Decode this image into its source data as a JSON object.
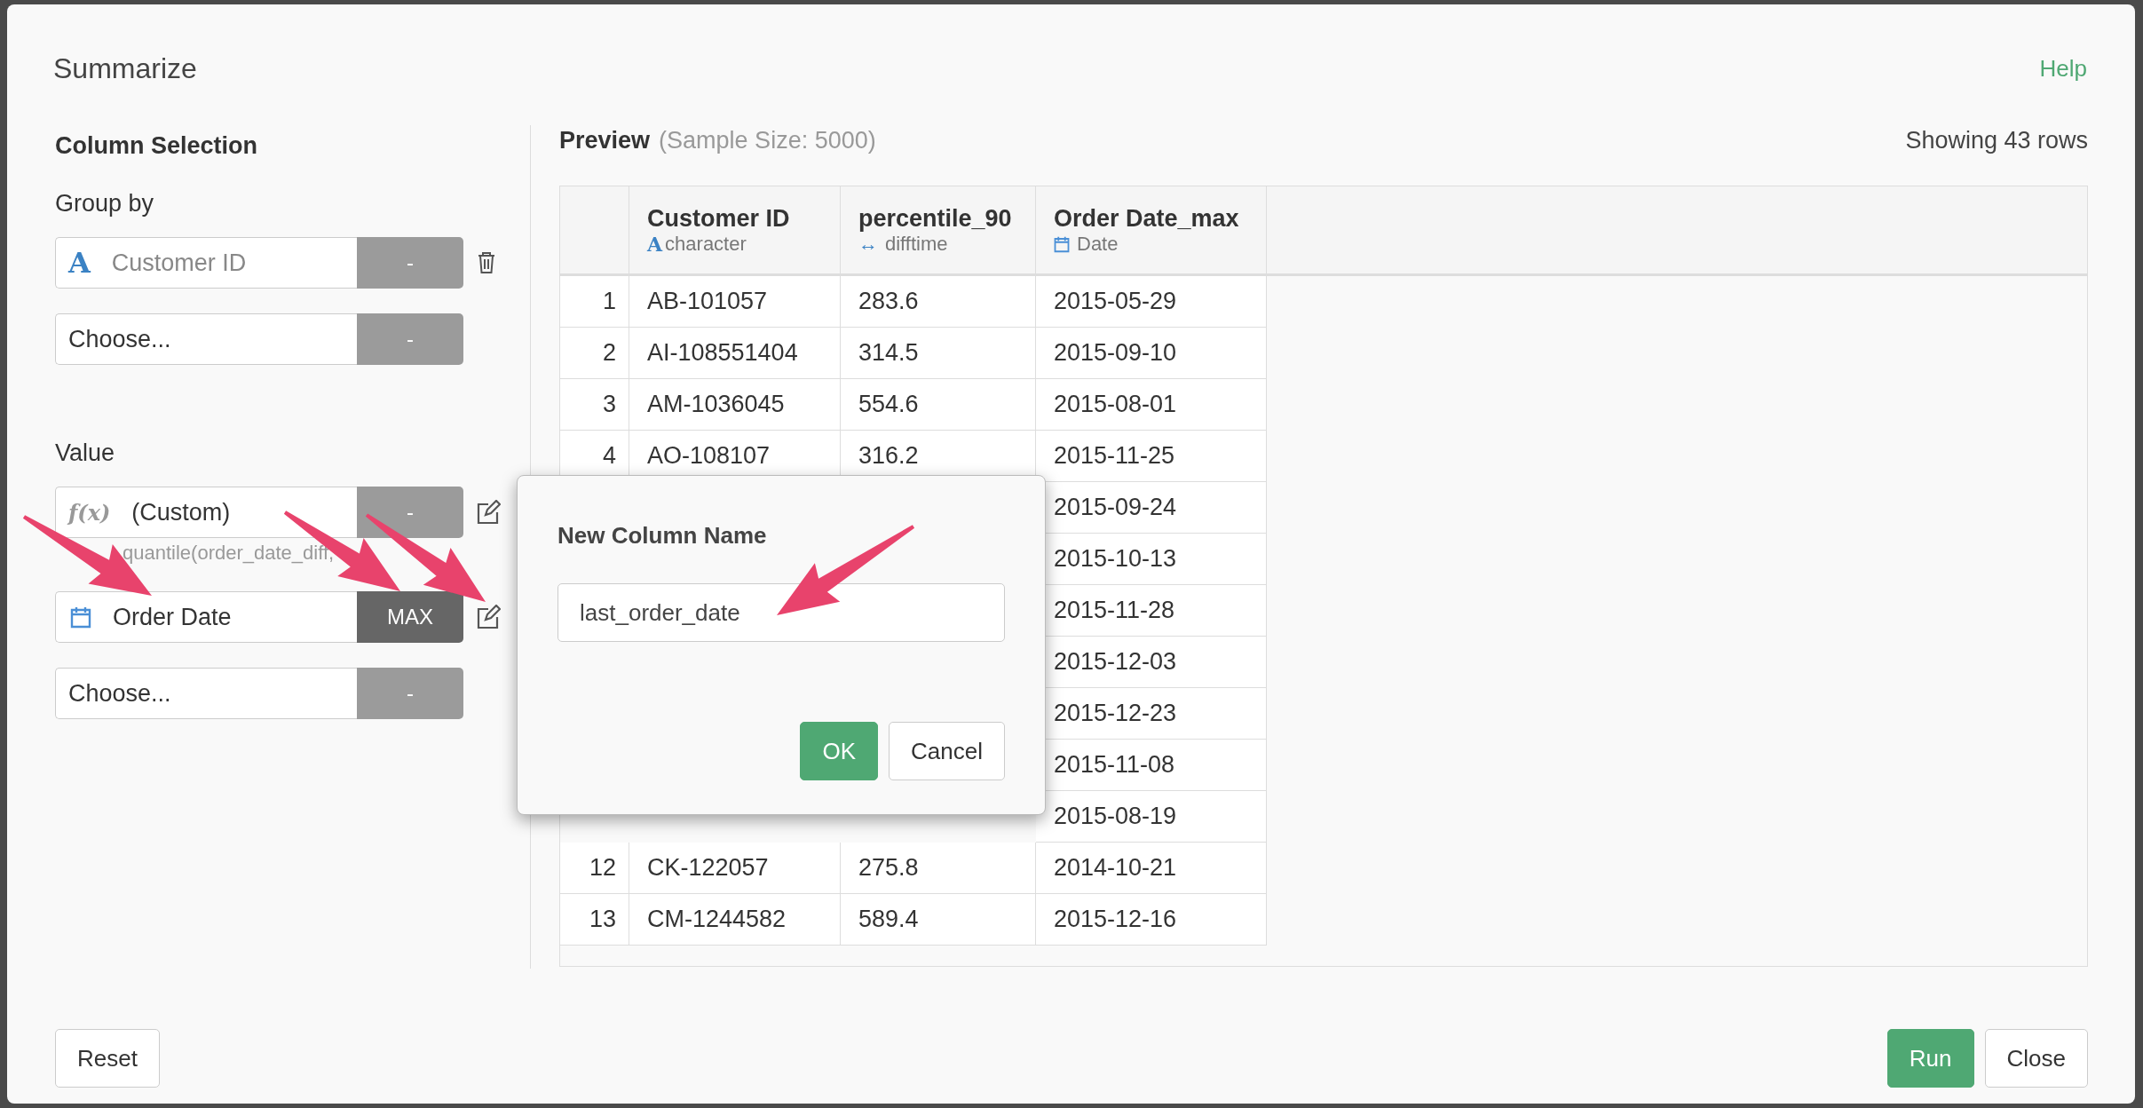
{
  "dialog": {
    "title": "Summarize",
    "help": "Help"
  },
  "column_selection": {
    "title": "Column Selection",
    "sections": [
      {
        "label": "Group by",
        "rows": [
          {
            "kind": "character",
            "glyph": "A",
            "text": "Customer ID",
            "dimmed": true,
            "function": "-",
            "active": false,
            "action": {
              "kind": "delete"
            }
          },
          {
            "text": "Choose...",
            "dimmed": false,
            "function": "-",
            "active": false
          }
        ]
      },
      {
        "label": "Value",
        "rows": [
          {
            "kind": "custom",
            "glyph": "f(x)",
            "text": "(Custom)",
            "dimmed": false,
            "function": "-",
            "active": false,
            "action": {
              "kind": "edit"
            },
            "formula": "quantile(order_date_diff,"
          },
          {
            "kind": "date",
            "text": "Order Date",
            "dimmed": false,
            "function": "MAX",
            "active": true,
            "action": {
              "kind": "edit"
            }
          },
          {
            "text": "Choose...",
            "dimmed": false,
            "function": "-",
            "active": false
          }
        ]
      }
    ]
  },
  "preview": {
    "title": "Preview",
    "subtitle": "(Sample Size: 5000)",
    "row_count": "Showing 43 rows",
    "columns": [
      {
        "name": "Customer ID",
        "kind": "character",
        "glyph": "A",
        "type_label": "character"
      },
      {
        "name": "percentile_90",
        "kind": "difftime",
        "glyph": "↔",
        "type_label": "difftime"
      },
      {
        "name": "Order Date_max",
        "kind": "date",
        "type_label": "Date"
      }
    ],
    "rows": [
      {
        "index": "1",
        "cells": [
          "AB-101057",
          "283.6",
          "2015-05-29"
        ]
      },
      {
        "index": "2",
        "cells": [
          "AI-108551404",
          "314.5",
          "2015-09-10"
        ]
      },
      {
        "index": "3",
        "cells": [
          "AM-1036045",
          "554.6",
          "2015-08-01"
        ]
      },
      {
        "index": "4",
        "cells": [
          "AO-108107",
          "316.2",
          "2015-11-25"
        ]
      },
      {
        "cells": [
          null,
          null,
          "2015-09-24"
        ]
      },
      {
        "cells": [
          null,
          null,
          "2015-10-13"
        ]
      },
      {
        "cells": [
          null,
          null,
          "2015-11-28"
        ]
      },
      {
        "cells": [
          null,
          null,
          "2015-12-03"
        ]
      },
      {
        "cells": [
          null,
          null,
          "2015-12-23"
        ]
      },
      {
        "cells": [
          null,
          null,
          "2015-11-08"
        ]
      },
      {
        "cells": [
          null,
          null,
          "2015-08-19"
        ]
      },
      {
        "index": "12",
        "cells": [
          "CK-122057",
          "275.8",
          "2014-10-21"
        ]
      },
      {
        "index": "13",
        "cells": [
          "CM-1244582",
          "589.4",
          "2015-12-16"
        ]
      }
    ]
  },
  "popup": {
    "title": "New Column Name",
    "value": "last_order_date",
    "buttons": [
      {
        "label": "OK",
        "kind": "primary"
      },
      {
        "label": "Cancel",
        "kind": "default"
      }
    ]
  },
  "footer": {
    "left": [
      {
        "label": "Reset",
        "kind": "default"
      }
    ],
    "right": [
      {
        "label": "Run",
        "kind": "primary"
      },
      {
        "label": "Close",
        "kind": "default"
      }
    ]
  }
}
